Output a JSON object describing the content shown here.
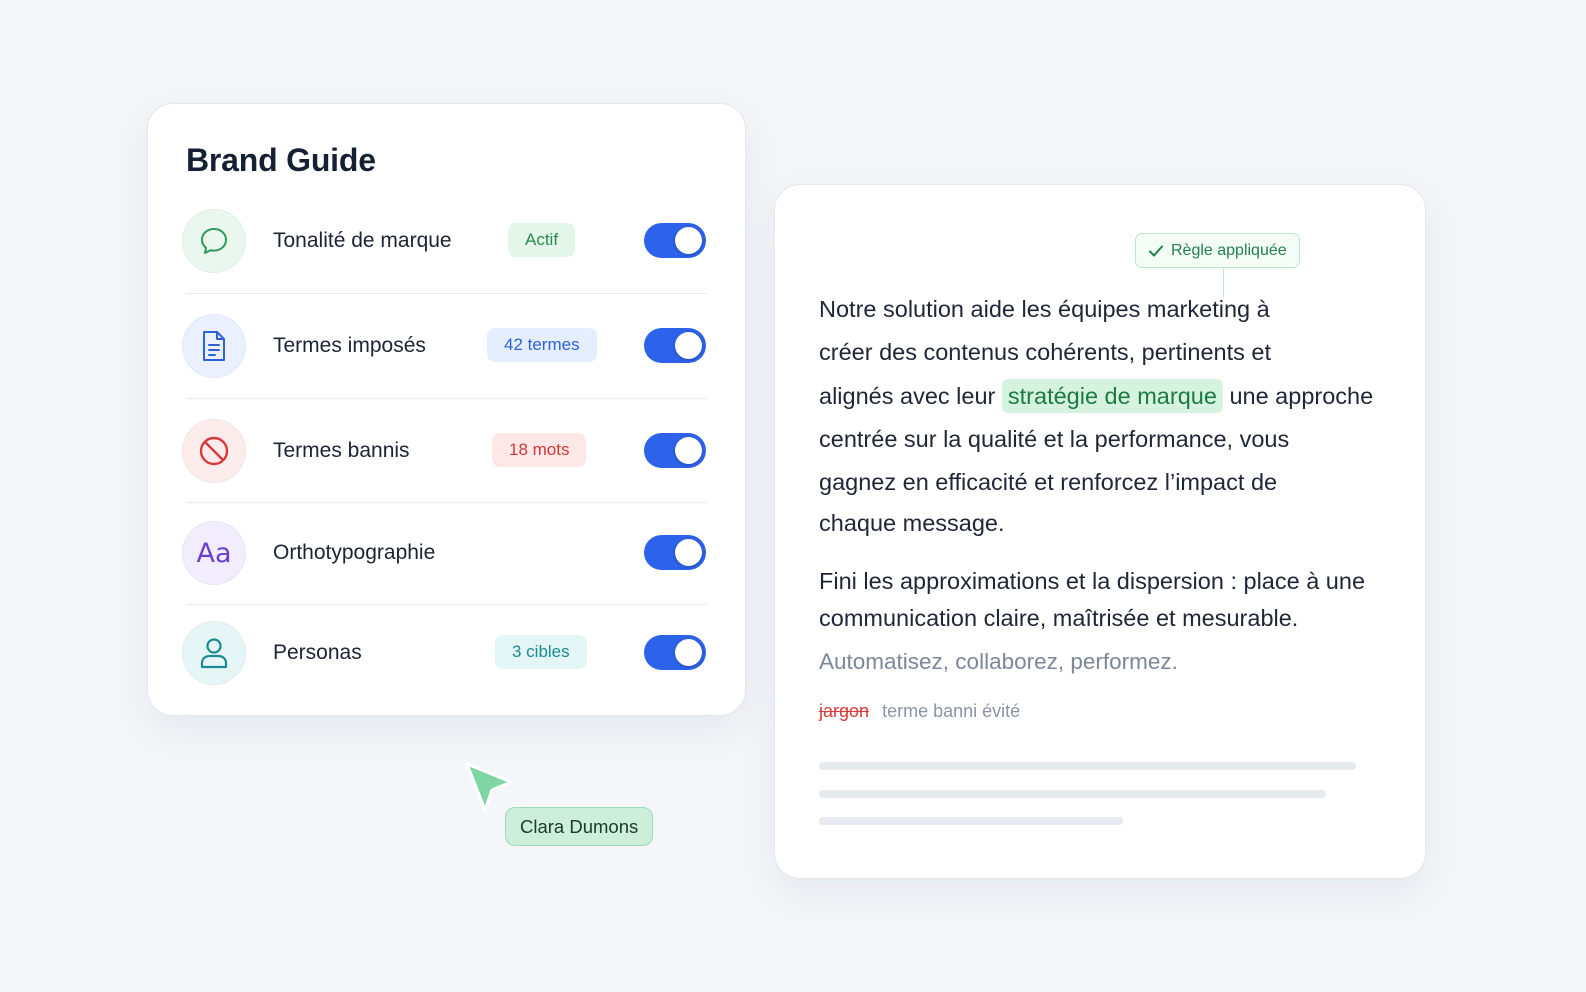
{
  "brand_guide": {
    "title": "Brand Guide",
    "rules": [
      {
        "label": "Tonalité de marque",
        "badge": "Actif",
        "icon": "chat-bubble-icon",
        "enabled": true
      },
      {
        "label": "Termes imposés",
        "badge": "42 termes",
        "icon": "document-icon",
        "enabled": true
      },
      {
        "label": "Termes bannis",
        "badge": "18 mots",
        "icon": "ban-icon",
        "enabled": true
      },
      {
        "label": "Orthotypographie",
        "badge": null,
        "icon": "typography-icon",
        "icon_text": "Aa",
        "enabled": true
      },
      {
        "label": "Personas",
        "badge": "3 cibles",
        "icon": "user-icon",
        "enabled": true
      }
    ]
  },
  "editor": {
    "rule_applied": "Règle appliquée",
    "paragraph1": {
      "line1": "Notre solution aide les équipes marketing à",
      "line2": "créer des contenus cohérents, pertinents et",
      "line3_before": "alignés avec leur",
      "line3_highlight": "stratégie de marque",
      "line3_after": "une approche",
      "line4": "centrée sur la qualité et la performance, vous",
      "line5": "gagnez en efficacité et renforcez l’impact de",
      "line6": "chaque message."
    },
    "paragraph2": {
      "line1": "Fini les approximations et la dispersion : place à une",
      "line2": "communication claire, maîtrisée et mesurable."
    },
    "slogan": "Automatisez, collaborez, performez.",
    "banned_word": "jargon",
    "banned_note": "terme banni évité"
  },
  "collaborator": {
    "name": "Clara Dumons"
  },
  "colors": {
    "toggle_on": "#2d62ea",
    "success_green": "#24804b",
    "danger_red": "#d93a3a",
    "info_blue": "#2f62d9",
    "purple": "#6b3fd0",
    "teal": "#1a8a94"
  }
}
